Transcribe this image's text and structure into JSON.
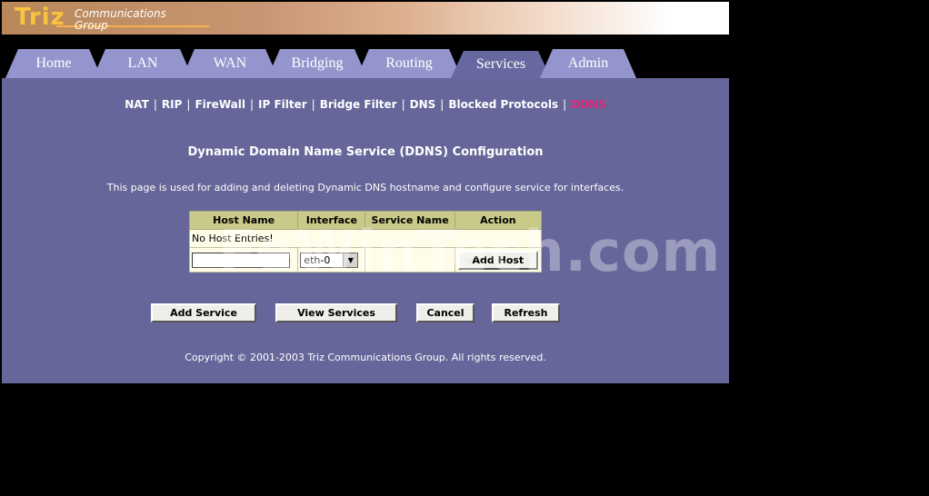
{
  "header": {
    "logo_main": "Triz",
    "logo_line1": "Communications",
    "logo_line2": "Group"
  },
  "tabs": [
    {
      "label": "Home"
    },
    {
      "label": "LAN"
    },
    {
      "label": "WAN"
    },
    {
      "label": "Bridging"
    },
    {
      "label": "Routing"
    },
    {
      "label": "Services",
      "active": true
    },
    {
      "label": "Admin"
    }
  ],
  "subnav": {
    "items": [
      "NAT",
      "RIP",
      "FireWall",
      "IP Filter",
      "Bridge Filter",
      "DNS",
      "Blocked Protocols",
      "DDNS"
    ],
    "separator": "|",
    "current": "DDNS"
  },
  "page": {
    "title": "Dynamic Domain Name Service (DDNS) Configuration",
    "description": "This page is used for adding and deleting Dynamic DNS hostname and configure service for interfaces."
  },
  "host_table": {
    "columns": [
      "Host Name",
      "Interface",
      "Service Name",
      "Action"
    ],
    "empty_message": "No Host Entries!",
    "host_input_value": "",
    "interface_selected": "eth-0",
    "add_host_label": "Add Host"
  },
  "buttons": {
    "add_service": "Add Service",
    "view_services": "View Services",
    "cancel": "Cancel",
    "refresh": "Refresh"
  },
  "footer": {
    "copyright": "Copyright © 2001-2003 Triz Communications Group. All rights reserved."
  },
  "watermark": "FeWinTech.com",
  "colors": {
    "content_bg": "#66669a",
    "tab_bg": "#9595cd",
    "tab_active_bg": "#6868a0",
    "current_link": "#e0277a",
    "table_header_bg": "#c9c98a",
    "table_bg": "#fffde8",
    "logo_gold": "#f7c341"
  }
}
